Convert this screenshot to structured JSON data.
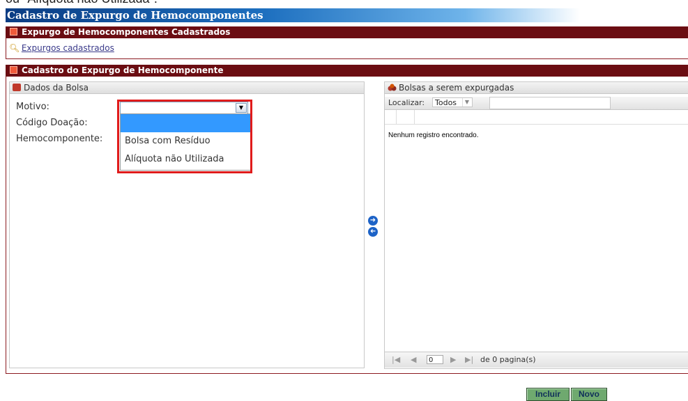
{
  "top_cut_text": "ou \"Alíquota não Utilizada\".",
  "page_title": "Cadastro de Expurgo de Hemocomponentes",
  "section1": {
    "title": "Expurgo de Hemocomponentes Cadastrados",
    "link": "Expurgos cadastrados"
  },
  "section2": {
    "title": "Cadastro do Expurgo de Hemocomponente"
  },
  "left_panel": {
    "title": "Dados da Bolsa",
    "labels": [
      "Motivo:",
      "Código Doação:",
      "Hemocomponente:"
    ],
    "motivo_value": "",
    "dropdown_options": [
      "",
      "Bolsa com Resíduo",
      "Alíquota não Utilizada"
    ]
  },
  "right_panel": {
    "title": "Bolsas a serem expurgadas",
    "search_label": "Localizar:",
    "search_filter": "Todos",
    "search_text": "",
    "empty_message": "Nenhum registro encontrado.",
    "page_value": "0",
    "page_suffix": "de 0 pagina(s)"
  },
  "buttons": {
    "incluir": "Incluir",
    "novo": "Novo"
  },
  "icons": {
    "link_icon": "magnifier-icon",
    "arrow_right": "circle-arrow-right-icon",
    "arrow_left": "circle-arrow-left-icon"
  }
}
